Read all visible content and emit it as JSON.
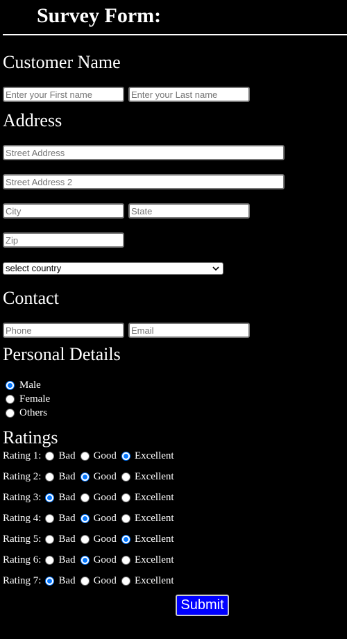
{
  "form": {
    "title": "Survey Form:",
    "submit_label": "Submit"
  },
  "customer_name": {
    "heading": "Customer Name",
    "first_name_placeholder": "Enter your First name",
    "last_name_placeholder": "Enter your Last name"
  },
  "address": {
    "heading": "Address",
    "street_placeholder": "Street Address",
    "street2_placeholder": "Street Address 2",
    "city_placeholder": "City",
    "state_placeholder": "State",
    "zip_placeholder": "Zip",
    "country_selected": "select country"
  },
  "contact": {
    "heading": "Contact",
    "phone_placeholder": "Phone",
    "email_placeholder": "Email"
  },
  "personal_details": {
    "heading": "Personal Details",
    "gender_options": [
      {
        "label": "Male",
        "checked": true
      },
      {
        "label": "Female",
        "checked": false
      },
      {
        "label": "Others",
        "checked": false
      }
    ]
  },
  "ratings": {
    "heading": "Ratings",
    "option_labels": [
      "Bad",
      "Good",
      "Excellent"
    ],
    "items": [
      {
        "label": "Rating 1:",
        "selected": "Excellent"
      },
      {
        "label": "Rating 2:",
        "selected": "Good"
      },
      {
        "label": "Rating 3:",
        "selected": "Bad"
      },
      {
        "label": "Rating 4:",
        "selected": "Good"
      },
      {
        "label": "Rating 5:",
        "selected": "Excellent"
      },
      {
        "label": "Rating 6:",
        "selected": "Good"
      },
      {
        "label": "Rating 7:",
        "selected": "Bad"
      }
    ]
  },
  "colors": {
    "background": "#000000",
    "text": "#ffffff",
    "radio_accent": "#0075ff",
    "submit_background": "#0000ff"
  }
}
